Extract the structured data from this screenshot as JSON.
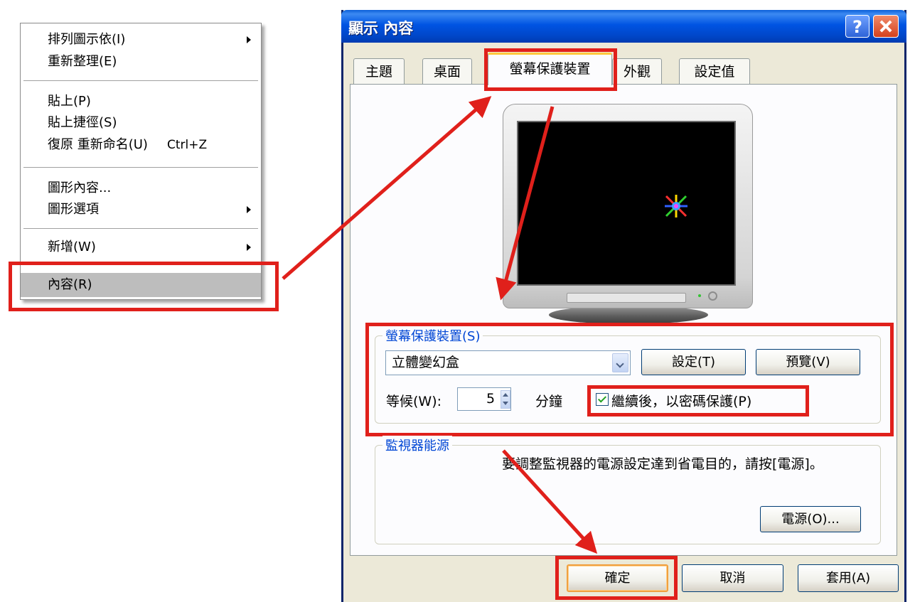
{
  "context_menu": {
    "arrange_icons": "排列圖示依(I)",
    "refresh": "重新整理(E)",
    "paste": "貼上(P)",
    "paste_shortcut": "貼上捷徑(S)",
    "undo_rename": "復原 重新命名(U)",
    "undo_shortcut": "Ctrl+Z",
    "graphics_properties": "圖形內容...",
    "graphics_options": "圖形選項",
    "new": "新增(W)",
    "properties": "內容(R)"
  },
  "dialog": {
    "title": "顯示 內容",
    "help_glyph": "?",
    "tabs": [
      "主題",
      "桌面",
      "螢幕保護裝置",
      "外觀",
      "設定值"
    ],
    "active_tab": "螢幕保護裝置",
    "screensaver_group": {
      "legend": "螢幕保護裝置(S)",
      "selected": "立體變幻盒",
      "settings_button": "設定(T)",
      "preview_button": "預覽(V)",
      "wait_label": "等候(W):",
      "wait_value": "5",
      "wait_unit": "分鐘",
      "password_label": "繼續後，以密碼保護(P)",
      "password_checked": true
    },
    "monitor_power_group": {
      "legend": "監視器能源",
      "text": "要調整監視器的電源設定達到省電目的，請按[電源]。",
      "power_button": "電源(O)..."
    },
    "ok_button": "確定",
    "cancel_button": "取消",
    "apply_button": "套用(A)"
  },
  "colors": {
    "annotation": "#e0201b",
    "title_bar": "#0054e3",
    "legend_text": "#0046d5",
    "dialog_bg": "#ece9d8"
  }
}
